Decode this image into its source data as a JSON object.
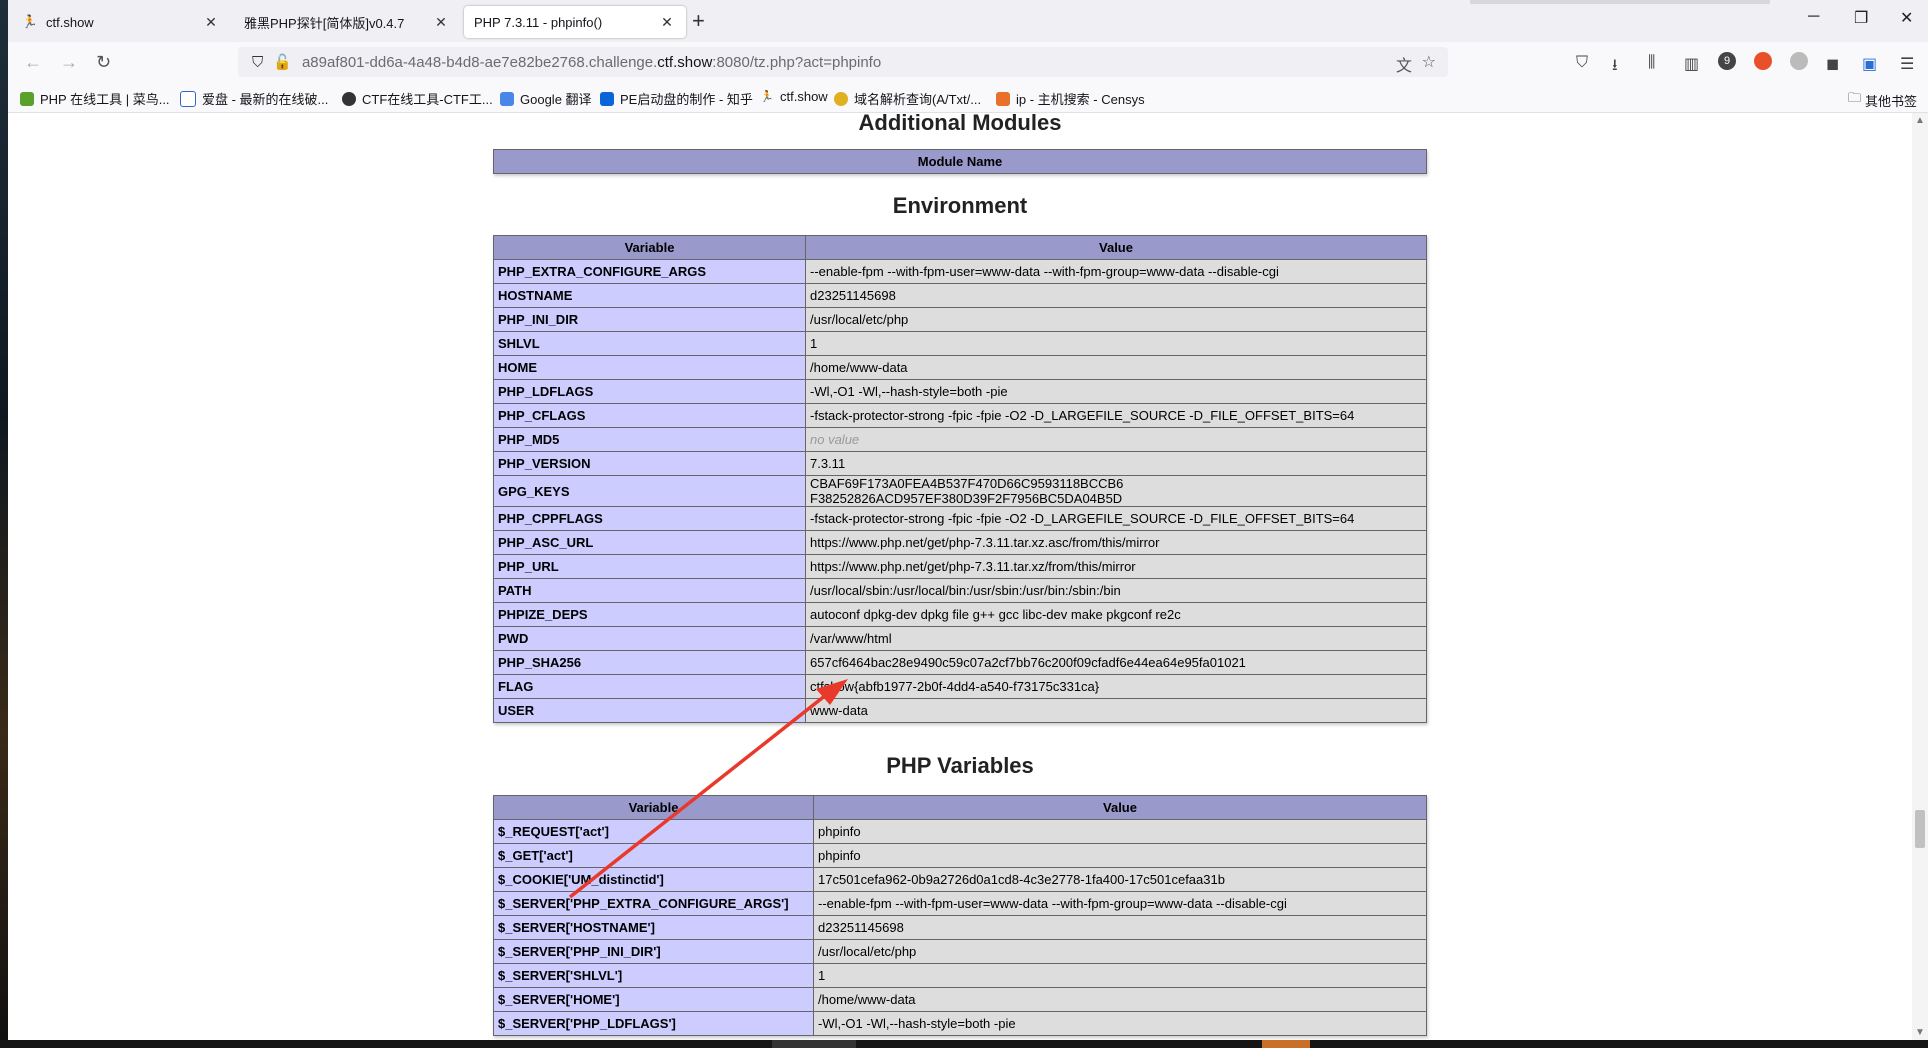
{
  "tabs": [
    {
      "title": "ctf.show",
      "icon": "ctfshow-icon"
    },
    {
      "title": "雅黑PHP探针[简体版]v0.4.7",
      "icon": "none"
    },
    {
      "title": "PHP 7.3.11 - phpinfo()",
      "icon": "none",
      "active": true
    }
  ],
  "url": {
    "prefix": "a89af801-dd6a-4a48-b4d8-ae7e82be2768.challenge.",
    "domain": "ctf.show",
    "suffix": ":8080/tz.php?act=phpinfo"
  },
  "bookmarks": [
    "PHP 在线工具 | 菜鸟...",
    "爱盘 - 最新的在线破...",
    "CTF在线工具-CTF工...",
    "Google 翻译",
    "PE启动盘的制作 - 知乎",
    "ctf.show",
    "域名解析查询(A/Txt/...",
    "ip - 主机搜索 - Censys"
  ],
  "bookmarks_other": "其他书签",
  "toolbar_badge": "9",
  "page": {
    "modules_title": "Additional Modules",
    "modules_header": "Module Name",
    "env_title": "Environment",
    "env_headers": [
      "Variable",
      "Value"
    ],
    "env_rows": [
      [
        "PHP_EXTRA_CONFIGURE_ARGS",
        "--enable-fpm --with-fpm-user=www-data --with-fpm-group=www-data --disable-cgi"
      ],
      [
        "HOSTNAME",
        "d23251145698"
      ],
      [
        "PHP_INI_DIR",
        "/usr/local/etc/php"
      ],
      [
        "SHLVL",
        "1"
      ],
      [
        "HOME",
        "/home/www-data"
      ],
      [
        "PHP_LDFLAGS",
        "-Wl,-O1 -Wl,--hash-style=both -pie"
      ],
      [
        "PHP_CFLAGS",
        "-fstack-protector-strong -fpic -fpie -O2 -D_LARGEFILE_SOURCE -D_FILE_OFFSET_BITS=64"
      ],
      [
        "PHP_MD5",
        "no value"
      ],
      [
        "PHP_VERSION",
        "7.3.11"
      ],
      [
        "GPG_KEYS",
        "CBAF69F173A0FEA4B537F470D66C9593118BCCB6 F38252826ACD957EF380D39F2F7956BC5DA04B5D"
      ],
      [
        "PHP_CPPFLAGS",
        "-fstack-protector-strong -fpic -fpie -O2 -D_LARGEFILE_SOURCE -D_FILE_OFFSET_BITS=64"
      ],
      [
        "PHP_ASC_URL",
        "https://www.php.net/get/php-7.3.11.tar.xz.asc/from/this/mirror"
      ],
      [
        "PHP_URL",
        "https://www.php.net/get/php-7.3.11.tar.xz/from/this/mirror"
      ],
      [
        "PATH",
        "/usr/local/sbin:/usr/local/bin:/usr/sbin:/usr/bin:/sbin:/bin"
      ],
      [
        "PHPIZE_DEPS",
        "autoconf dpkg-dev dpkg file g++ gcc libc-dev make pkgconf re2c"
      ],
      [
        "PWD",
        "/var/www/html"
      ],
      [
        "PHP_SHA256",
        "657cf6464bac28e9490c59c07a2cf7bb76c200f09cfadf6e44ea64e95fa01021"
      ],
      [
        "FLAG",
        "ctfshow{abfb1977-2b0f-4dd4-a540-f73175c331ca}"
      ],
      [
        "USER",
        "www-data"
      ]
    ],
    "vars_title": "PHP Variables",
    "vars_headers": [
      "Variable",
      "Value"
    ],
    "vars_rows": [
      [
        "$_REQUEST['act']",
        "phpinfo"
      ],
      [
        "$_GET['act']",
        "phpinfo"
      ],
      [
        "$_COOKIE['UM_distinctid']",
        "17c501cefa962-0b9a2726d0a1cd8-4c3e2778-1fa400-17c501cefaa31b"
      ],
      [
        "$_SERVER['PHP_EXTRA_CONFIGURE_ARGS']",
        "--enable-fpm --with-fpm-user=www-data --with-fpm-group=www-data --disable-cgi"
      ],
      [
        "$_SERVER['HOSTNAME']",
        "d23251145698"
      ],
      [
        "$_SERVER['PHP_INI_DIR']",
        "/usr/local/etc/php"
      ],
      [
        "$_SERVER['SHLVL']",
        "1"
      ],
      [
        "$_SERVER['HOME']",
        "/home/www-data"
      ],
      [
        "$_SERVER['PHP_LDFLAGS']",
        "-Wl,-O1 -Wl,--hash-style=both -pie"
      ]
    ]
  },
  "colors": {
    "header_bg": "#9999cc",
    "key_bg": "#ccccff",
    "value_bg": "#dddddd",
    "annotation_arrow": "#e8392b"
  }
}
